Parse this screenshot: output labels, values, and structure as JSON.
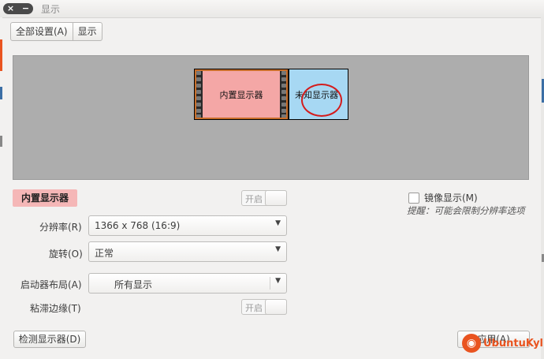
{
  "window": {
    "title": "显示",
    "close_glyph": "×",
    "minimize_glyph": "−"
  },
  "breadcrumb": {
    "items": [
      "全部设置(A)",
      "显示"
    ]
  },
  "arrangement": {
    "builtin_monitor_label": "内置显示器",
    "unknown_monitor_label": "未知显示器",
    "highlight_color": "#d41c1c"
  },
  "selected_display": {
    "name": "内置显示器",
    "power_toggle_label": "开启",
    "power_on": false
  },
  "mirror": {
    "label": "镜像显示(M)",
    "checked": false,
    "hint": "提醒：可能会限制分辨率选项"
  },
  "settings": {
    "resolution": {
      "label": "分辨率(R)",
      "value": "1366 x 768 (16:9)"
    },
    "rotation": {
      "label": "旋转(O)",
      "value": "正常"
    },
    "launcher_layout": {
      "label": "启动器布局(A)",
      "value": "所有显示"
    },
    "sticky_edges": {
      "label": "粘滞边缘(T)",
      "toggle_label": "开启",
      "on": false
    }
  },
  "buttons": {
    "detect": "检测显示器(D)",
    "apply": "应用(A)"
  },
  "watermark": {
    "text": "UbuntuKylin",
    "icon": "ubuntu-logo-icon",
    "color": "#e95420"
  },
  "colors": {
    "builtin_fill": "#f4a7a6",
    "unknown_fill": "#a7d8f3",
    "canvas_bg": "#adadad",
    "selected_label_bg": "#f5b7b7"
  }
}
